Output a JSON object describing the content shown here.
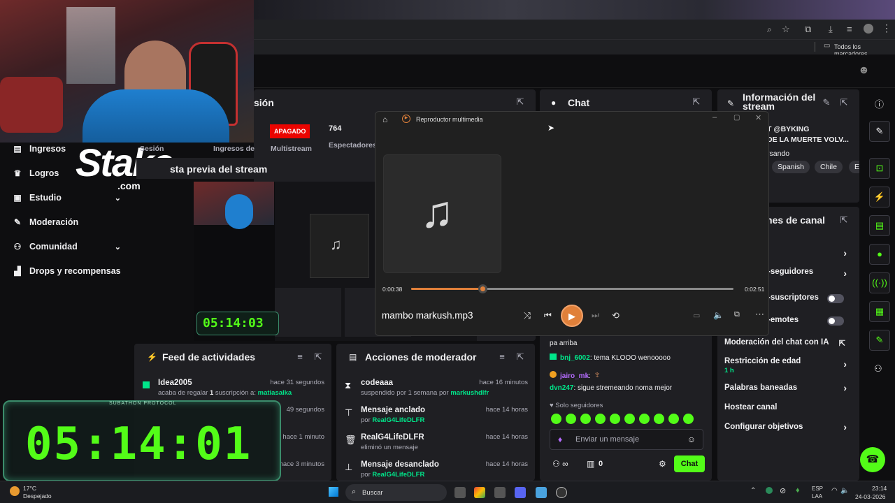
{
  "browser": {
    "bookmarks_label": "Todos los marcadores"
  },
  "dashboard": {
    "session_panel_title": "sión",
    "status_badge": "APAGADO",
    "viewers_count": "764",
    "stats_labels": [
      "Sesión",
      "Ingresos de",
      "Multistream",
      "Espectadores"
    ],
    "preview_title": "sta previa del stream"
  },
  "sidebar": {
    "items": [
      {
        "label": "Ingresos",
        "icon": "money-icon"
      },
      {
        "label": "Logros",
        "icon": "trophy-icon"
      },
      {
        "label": "Estudio",
        "icon": "studio-icon",
        "chevron": true
      },
      {
        "label": "Moderación",
        "icon": "wrench-icon"
      },
      {
        "label": "Comunidad",
        "icon": "people-icon",
        "chevron": true
      },
      {
        "label": "Drops y recompensas",
        "icon": "drops-icon"
      }
    ]
  },
  "overlay": {
    "stake_logo": "Stake",
    "stake_sub": ".com",
    "preview_timer": "05:14:03",
    "timer_label": "SUBATHON PROTOCOL",
    "timer": "05:14:01"
  },
  "activity_feed": {
    "title": "Feed de actividades",
    "rows": [
      {
        "name": "Idea2005",
        "time": "hace 31 segundos",
        "sub_pre": "acaba de regalar ",
        "count": "1",
        "sub_mid": " suscripción a: ",
        "target": "matiasalka"
      },
      {
        "name": "",
        "time": "49 segundos",
        "sub_pre": "",
        "count": "",
        "sub_mid": "",
        "target": ""
      },
      {
        "name": "",
        "time": "hace 1 minuto",
        "sub_pre": "",
        "count": "",
        "sub_mid": "",
        "target": ""
      },
      {
        "name": "",
        "time": "hace 3 minutos",
        "sub_pre": "",
        "count": "",
        "sub_mid": "",
        "target": ""
      }
    ]
  },
  "mod_actions": {
    "title": "Acciones de moderador",
    "rows": [
      {
        "name": "codeaaa",
        "time": "hace 16 minutos",
        "sub": "suspendido por 1 semana por ",
        "who": "markushdlfr",
        "icon": "hourglass-icon"
      },
      {
        "name": "Mensaje anclado",
        "time": "hace 14 horas",
        "sub": "por ",
        "who": "RealG4LifeDLFR",
        "icon": "pin-icon"
      },
      {
        "name": "RealG4LifeDLFR",
        "time": "hace 14 horas",
        "sub": "eliminó un mensaje",
        "who": "",
        "icon": "trash-icon"
      },
      {
        "name": "Mensaje desanclado",
        "time": "hace 14 horas",
        "sub": "por ",
        "who": "RealG4LifeDLFR",
        "icon": "unpin-icon"
      }
    ]
  },
  "chat": {
    "title": "Chat",
    "messages": [
      {
        "user": "",
        "text": "pa arriba"
      },
      {
        "user": "bnj_6002",
        "text": ": tema KLOOO wenooooo",
        "color": "#00e68a"
      },
      {
        "user": "jairo_mk",
        "text": ":",
        "color": "#b56cff"
      },
      {
        "user": "dvn247",
        "text": ": sigue stremeando noma mejor",
        "color": "#00e68a"
      }
    ],
    "followers_only": "Solo seguidores",
    "input_placeholder": "Enviar un mensaje",
    "points": "0",
    "send_button": "Chat"
  },
  "stream_info": {
    "title": "Información del stream",
    "line1": "T @BYKING",
    "line2": "DE LA MUERTE VOLV...",
    "category": "rsando",
    "tags": [
      "Spanish",
      "Chile",
      "Es"
    ]
  },
  "channel_settings": {
    "title": "nes de canal",
    "items": [
      {
        "label": "",
        "type": "chevron"
      },
      {
        "label": "-seguidores",
        "type": "chevron"
      },
      {
        "label": "-suscriptores",
        "type": "toggle"
      },
      {
        "label": "-emotes",
        "type": "toggle"
      },
      {
        "label": "Moderación del chat con IA",
        "type": "external"
      },
      {
        "label": "Restricción de edad",
        "sub": "1 h",
        "type": "chevron"
      },
      {
        "label": "Palabras baneadas",
        "type": "chevron"
      },
      {
        "label": "Hostear canal",
        "type": "none"
      },
      {
        "label": "Configurar objetivos",
        "type": "chevron"
      }
    ]
  },
  "player": {
    "app_title": "Reproductor multimedia",
    "track": "mambo markush.mp3",
    "elapsed": "0:00:38",
    "total": "0:02:51",
    "progress": 0.222
  },
  "taskbar": {
    "weather_temp": "17°C",
    "weather_desc": "Despejado",
    "search_label": "Buscar",
    "lang1": "ESP",
    "lang2": "LAA",
    "time": "23:14",
    "date": "24-03-2026"
  },
  "colors": {
    "accent_green": "#53fc18",
    "link_green": "#00e68a",
    "danger": "#eb0400",
    "player_accent": "#e0803a"
  }
}
